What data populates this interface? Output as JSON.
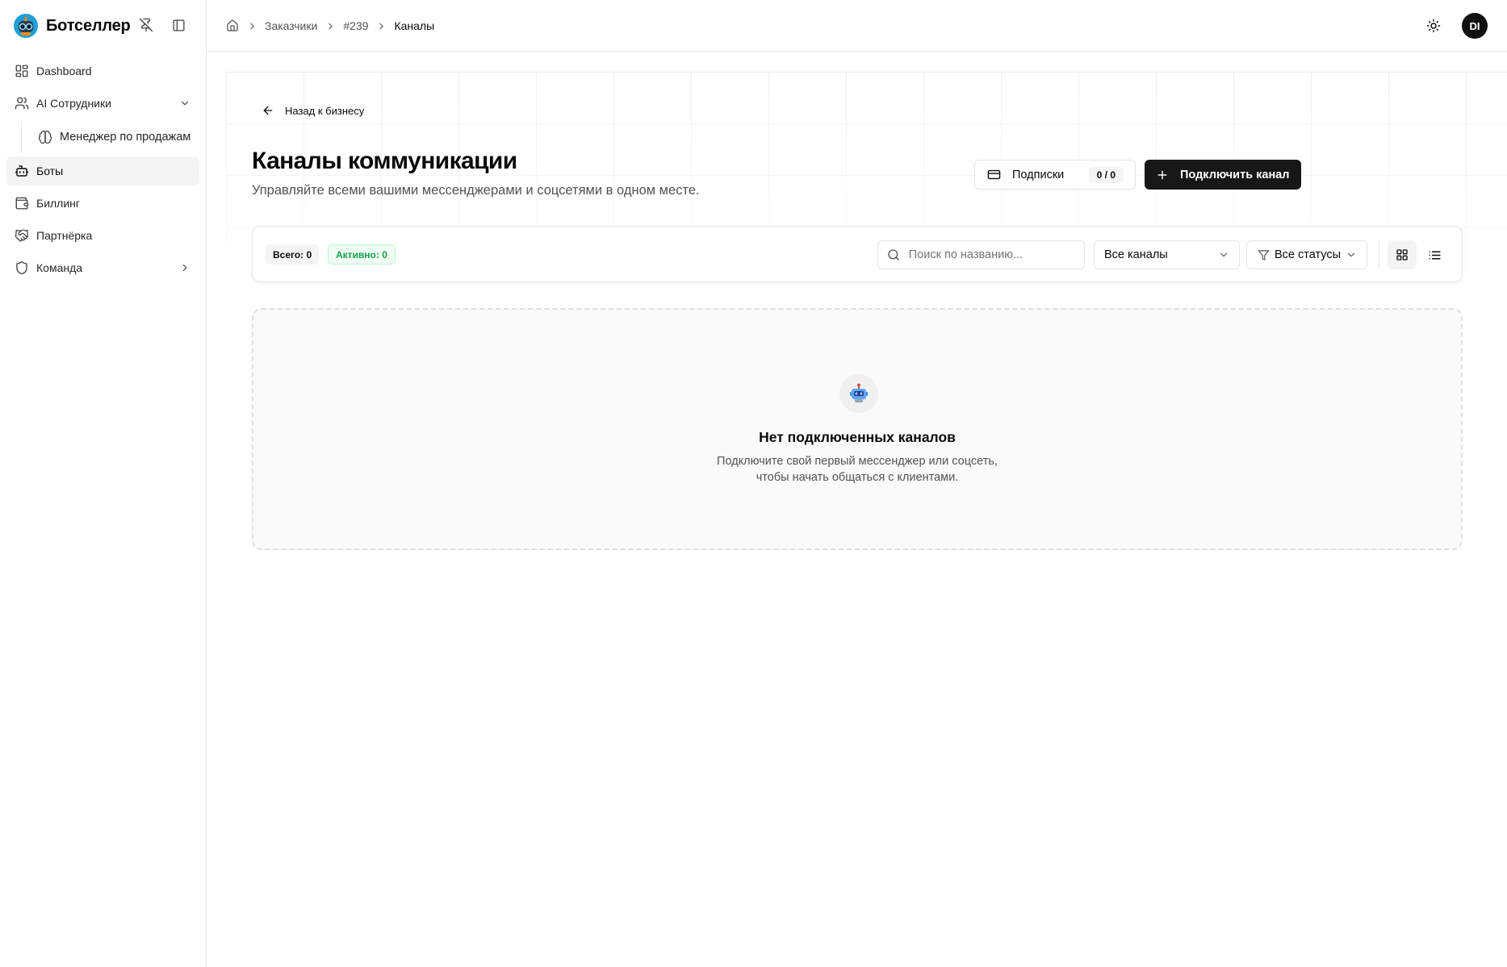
{
  "brand": {
    "name": "Ботселлер"
  },
  "sidebar": {
    "items": [
      {
        "label": "Dashboard",
        "icon": "dashboard-icon"
      },
      {
        "label": "AI Сотрудники",
        "icon": "users-icon",
        "expanded": true,
        "children": [
          {
            "label": "Менеджер по продажам",
            "icon": "brain-icon"
          }
        ]
      },
      {
        "label": "Боты",
        "icon": "bot-icon",
        "active": true
      },
      {
        "label": "Биллинг",
        "icon": "wallet-icon"
      },
      {
        "label": "Партнёрка",
        "icon": "handshake-icon"
      },
      {
        "label": "Команда",
        "icon": "shield-icon",
        "expanded": false
      }
    ]
  },
  "header": {
    "breadcrumbs": [
      "Заказчики",
      "#239",
      "Каналы"
    ],
    "avatar_initials": "DI"
  },
  "page": {
    "back_label": "Назад к бизнесу",
    "title": "Каналы коммуникации",
    "subtitle": "Управляйте всеми вашими мессенджерами и соцсетями в одном месте.",
    "subscriptions_label": "Подписки",
    "subscriptions_count": "0 / 0",
    "connect_label": "Подключить канал"
  },
  "toolbar": {
    "total_label": "Всего: 0",
    "active_label": "Активно: 0",
    "search_placeholder": "Поиск по названию...",
    "channels_filter": "Все каналы",
    "status_filter": "Все статусы",
    "view_mode": "grid"
  },
  "empty_state": {
    "icon": "🤖",
    "title": "Нет подключенных каналов",
    "line1": "Подключите свой первый мессенджер или соцсеть,",
    "line2": "чтобы начать общаться с клиентами."
  },
  "colors": {
    "primary": "#171717",
    "active_green": "#16a34a",
    "border": "#e5e5e5"
  }
}
